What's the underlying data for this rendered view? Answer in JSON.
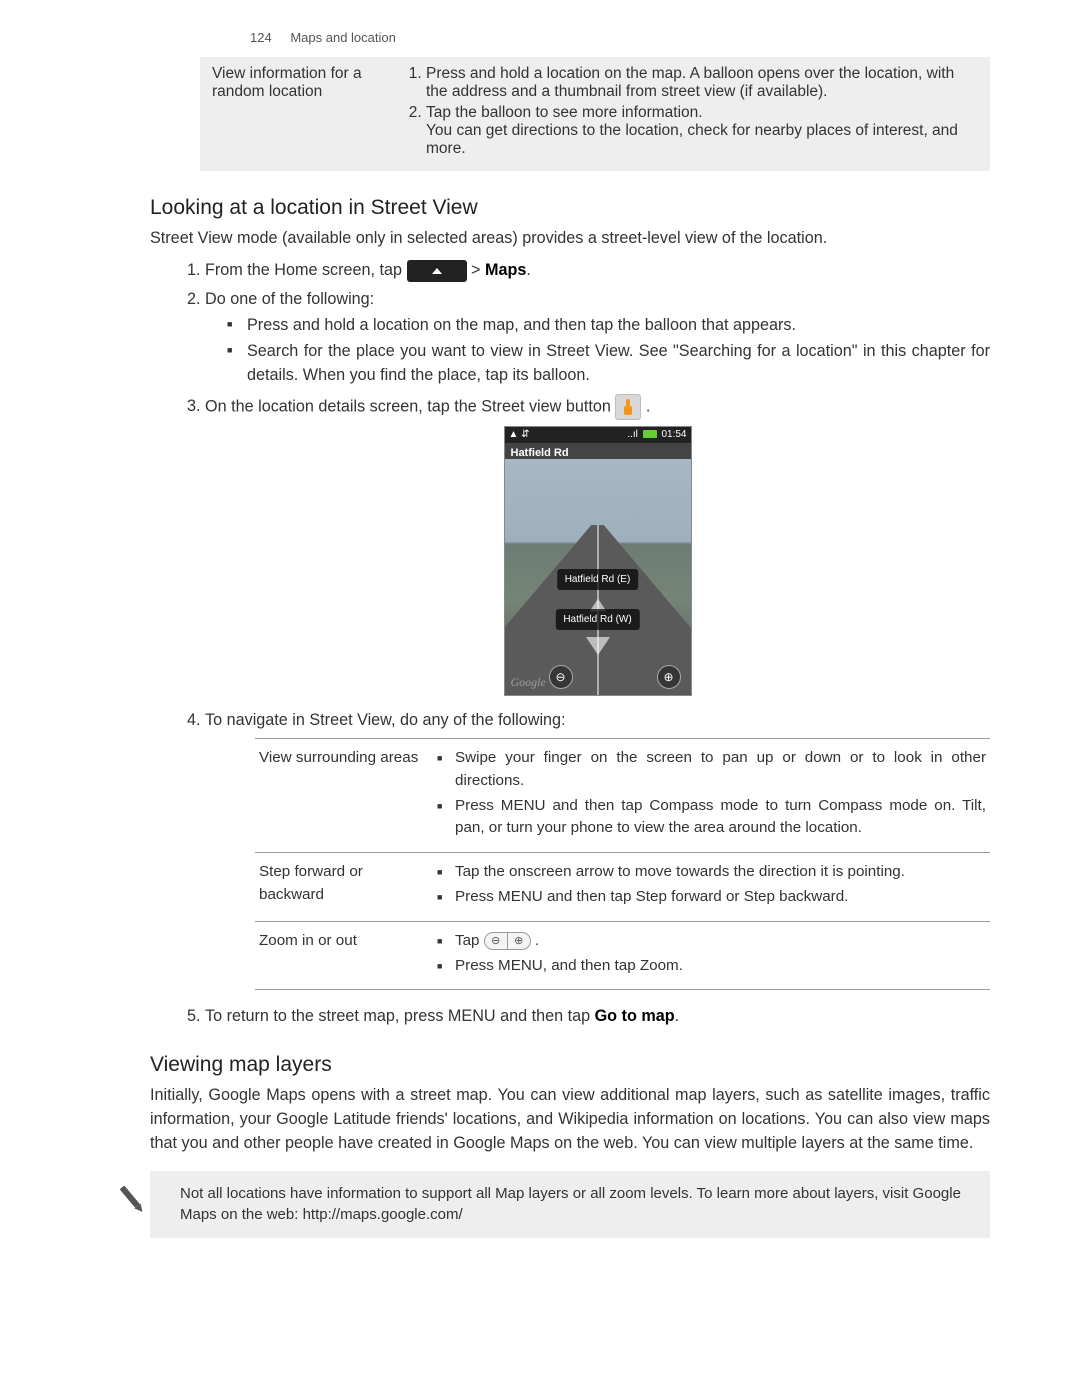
{
  "page": {
    "number": "124",
    "section": "Maps and location"
  },
  "topTable": {
    "label": "View information for a random location",
    "items": [
      "Press and hold a location on the map. A balloon opens over the location, with the address and a thumbnail from street view (if available).",
      "Tap the balloon to see more information."
    ],
    "note": "You can get directions to the location, check for nearby places of interest, and more."
  },
  "section1": {
    "heading": "Looking at a location in Street View",
    "intro": "Street View mode (available only in selected areas) provides a street-level view of the location.",
    "step1_pre": "From the Home screen, tap",
    "step1_post": "> ",
    "step1_app": "Maps",
    "step2": "Do one of the following:",
    "step2_bullets": [
      "Press and hold a location on the map, and then tap the balloon that appears.",
      "Search for the place you want to view in Street View. See \"Searching for a location\" in this chapter for details. When you find the place, tap its balloon."
    ],
    "step3": "On the location details screen, tap the Street view button",
    "step4": "To navigate in Street View, do any of the following:",
    "step5_pre": "To return to the street map, press MENU and then tap ",
    "step5_bold": "Go to map"
  },
  "screenshot": {
    "status_left": "▲ ⇵",
    "status_signal": "..ıl",
    "status_time": "01:54",
    "title": "Hatfield Rd",
    "label1": "Hatfield Rd (E)",
    "label2": "Hatfield Rd (W)",
    "watermark": "Google",
    "zoom_out": "⊖",
    "zoom_in": "⊕"
  },
  "navTable": {
    "rows": [
      {
        "label": "View surrounding areas",
        "bullets": [
          "Swipe your finger on the screen to pan up or down or to look in other directions.",
          "Press MENU and then tap Compass mode to turn Compass mode on. Tilt, pan, or turn your phone to view the area around the location."
        ]
      },
      {
        "label": "Step forward or backward",
        "bullets": [
          "Tap the onscreen arrow to move towards the direction it is pointing.",
          "Press MENU and then tap Step forward or Step backward."
        ]
      },
      {
        "label": "Zoom in or out",
        "bullets": [
          "Tap ",
          "Press MENU, and then tap Zoom."
        ]
      }
    ]
  },
  "section2": {
    "heading": "Viewing map layers",
    "para": "Initially, Google Maps opens with a street map. You can view additional map layers, such as satellite images, traffic information, your Google Latitude friends' locations, and Wikipedia information on locations. You can also view maps that you and other people have created in Google Maps on the web. You can view multiple layers at the same time.",
    "note": "Not all locations have information to support all Map layers or all zoom levels. To learn more about layers, visit Google Maps on the web: http://maps.google.com/"
  }
}
